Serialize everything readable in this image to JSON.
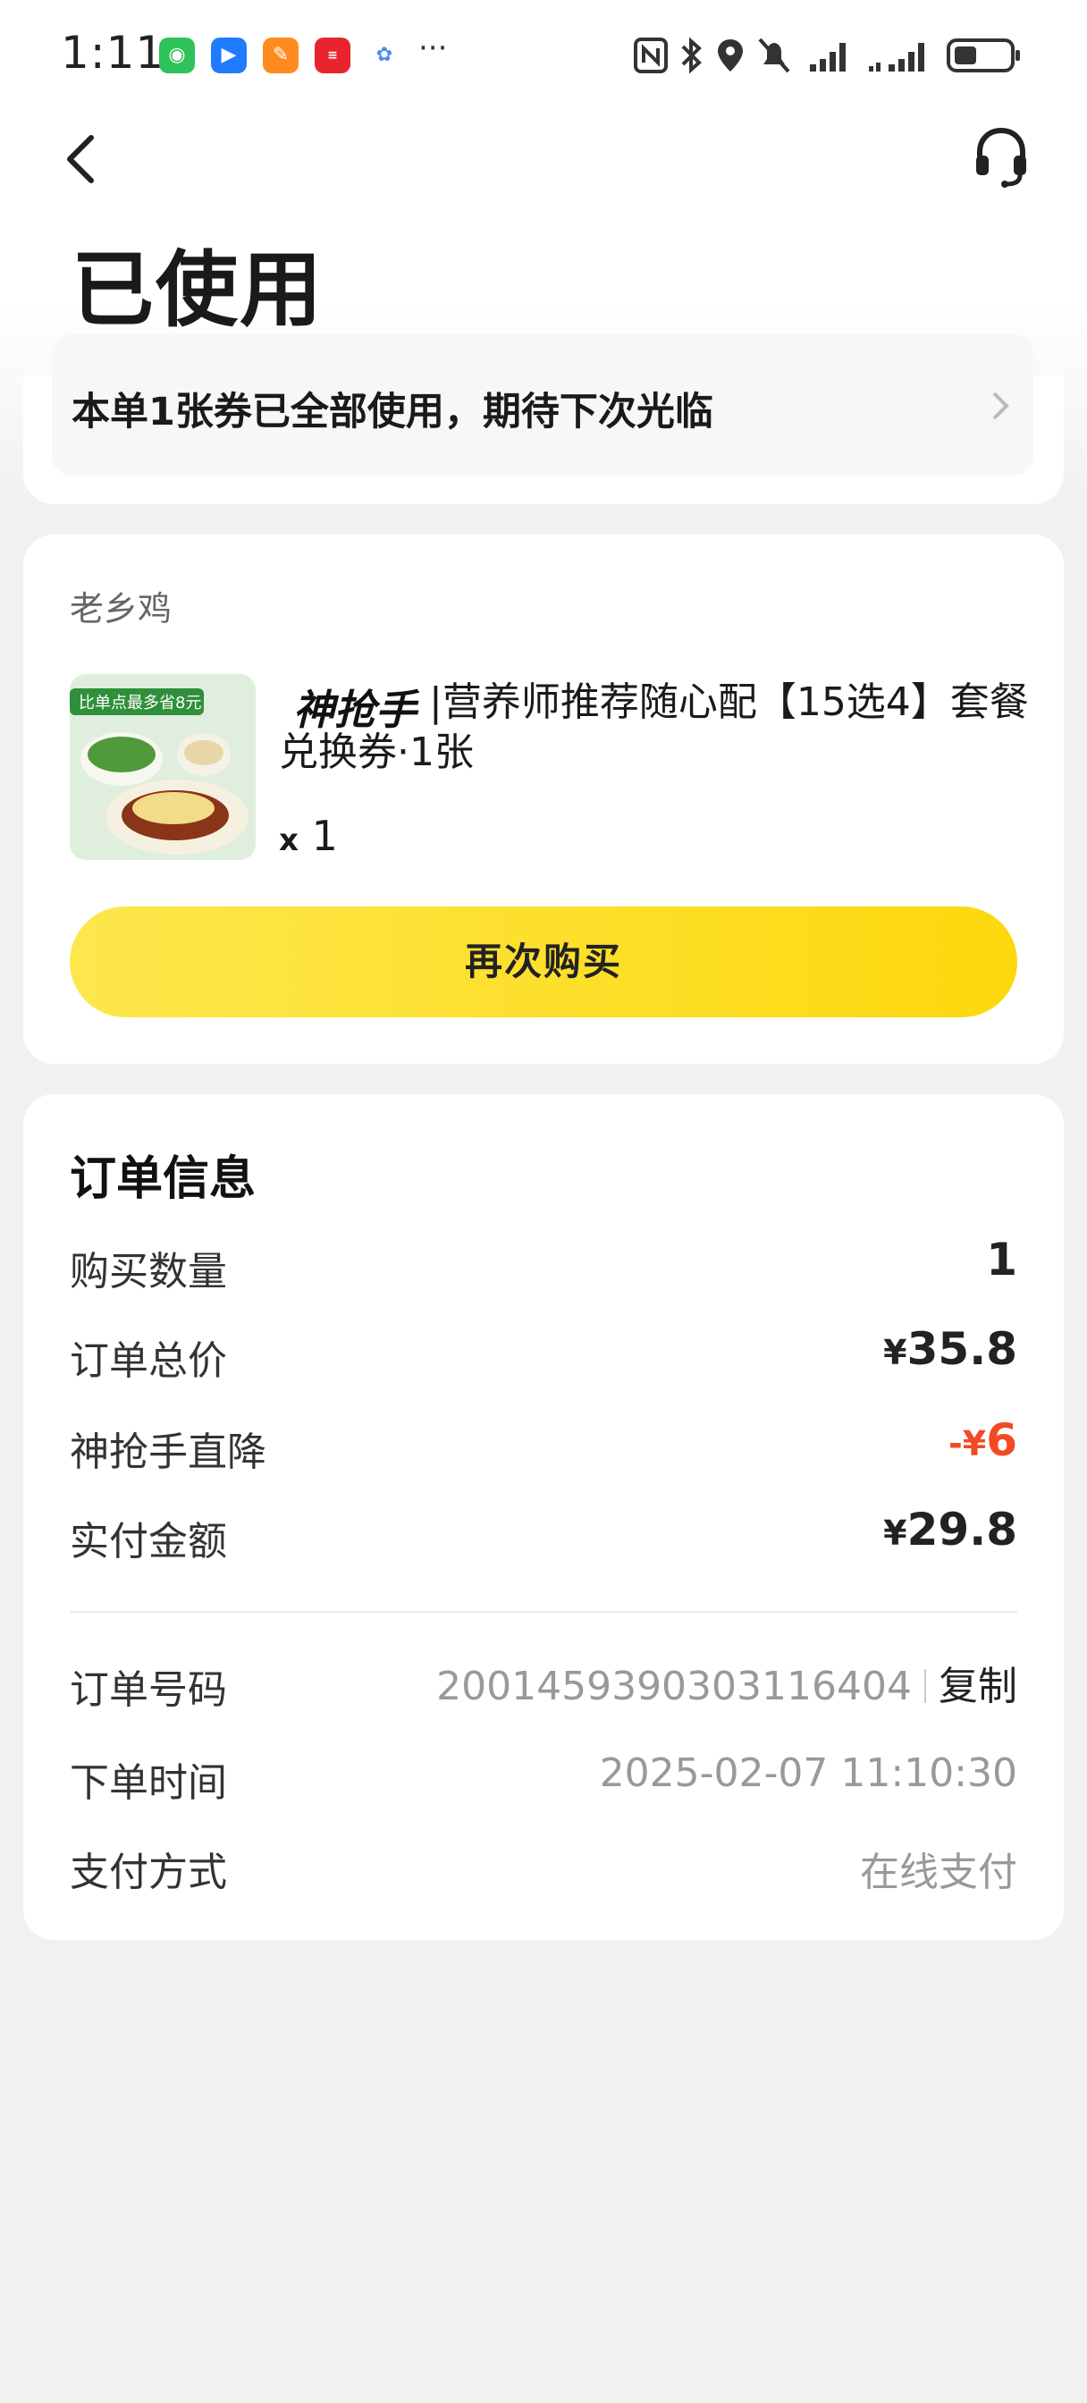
{
  "status_bar": {
    "time": "1:11",
    "more": "···"
  },
  "page": {
    "title": "已使用",
    "notice": "本单1张券已全部使用，期待下次光临"
  },
  "product": {
    "shop": "老乡鸡",
    "tag": "神抢手",
    "title": "|营养师推荐随心配【15选4】套餐兑换券·1张",
    "qty_prefix": "x",
    "qty": "1",
    "thumb_banner": "比单点最多省8元",
    "rebuy_label": "再次购买"
  },
  "order": {
    "heading": "订单信息",
    "rows": [
      {
        "label": "购买数量",
        "value": "1"
      },
      {
        "label": "订单总价",
        "currency": "¥",
        "value": "35.8"
      },
      {
        "label": "神抢手直降",
        "currency": "-¥",
        "value": "6"
      },
      {
        "label": "实付金额",
        "currency": "¥",
        "value": "29.8"
      }
    ],
    "details": [
      {
        "label": "订单号码",
        "value": "2001459390303116404",
        "action": "复制"
      },
      {
        "label": "下单时间",
        "value": "2025-02-07 11:10:30"
      },
      {
        "label": "支付方式",
        "value": "在线支付"
      }
    ]
  },
  "colors": {
    "accent_yellow": "#fdd80c",
    "discount_red": "#f24a25"
  }
}
